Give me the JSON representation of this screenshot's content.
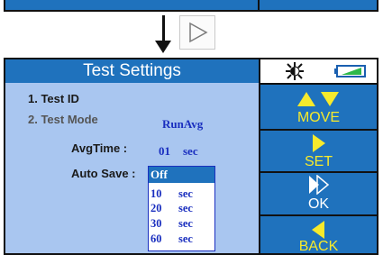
{
  "settings": {
    "title": "Test Settings",
    "items": [
      {
        "label": "1. Test ID"
      },
      {
        "label": "2. Test Mode",
        "value": "RunAvg"
      }
    ],
    "avg_time": {
      "label": "AvgTime :",
      "value": "01",
      "unit": "sec"
    },
    "auto_save": {
      "label": "Auto Save :",
      "selected": "Off",
      "options": [
        {
          "value": "10",
          "unit": "sec"
        },
        {
          "value": "20",
          "unit": "sec"
        },
        {
          "value": "30",
          "unit": "sec"
        },
        {
          "value": "60",
          "unit": "sec"
        }
      ]
    }
  },
  "controls": {
    "move_label": "MOVE",
    "set_label": "SET",
    "ok_label": "OK",
    "back_label": "BACK"
  },
  "status": {
    "icons": [
      "backlight-icon",
      "battery-icon"
    ]
  },
  "colors": {
    "panel_blue": "#1f72bd",
    "list_bg": "#a9c6f0",
    "accent_yellow": "#f7ea2c",
    "value_blue": "#1a2fbf"
  }
}
